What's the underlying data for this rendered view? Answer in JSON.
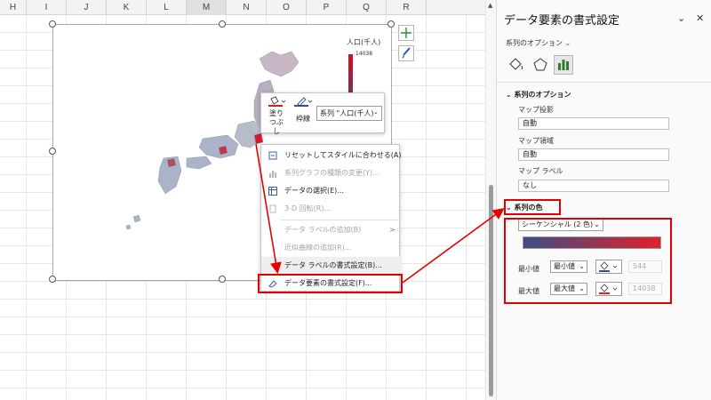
{
  "sheet": {
    "columns": [
      "H",
      "I",
      "J",
      "K",
      "L",
      "M",
      "N",
      "O",
      "P",
      "Q",
      "R"
    ]
  },
  "chart": {
    "legend_title": "人口(千人)",
    "legend_max": "14038",
    "colors": {
      "high": "#cc1122",
      "low": "#2b4f86",
      "land": "#aab3c8"
    }
  },
  "mini_toolbar": {
    "fill_label": "塗りつぶし",
    "outline_label": "枠線",
    "series_select": "系列 \"人口(千人)\""
  },
  "context_menu": {
    "items": [
      {
        "label": "リセットしてスタイルに合わせる(A)",
        "enabled": true
      },
      {
        "label": "系列グラフの種類の変更(Y)...",
        "enabled": false
      },
      {
        "label": "データの選択(E)...",
        "enabled": true
      },
      {
        "label": "3-D 回転(R)...",
        "enabled": false
      },
      {
        "label": "データ ラベルの追加(B)",
        "enabled": false
      },
      {
        "label": "近似曲線の追加(R)...",
        "enabled": false
      },
      {
        "label": "データ ラベルの書式設定(B)...",
        "enabled": true
      },
      {
        "label": "データ要素の書式設定(F)...",
        "enabled": true
      }
    ]
  },
  "pane": {
    "title": "データ要素の書式設定",
    "series_options_link": "系列のオプション",
    "section_series_options": "系列のオプション",
    "map_projection_label": "マップ投影",
    "map_projection_value": "自動",
    "map_area_label": "マップ領域",
    "map_area_value": "自動",
    "map_labels_label": "マップ ラベル",
    "map_labels_value": "なし",
    "section_series_color": "系列の色",
    "color_scheme": "シーケンシャル (2 色)",
    "min_label": "最小値",
    "min_type": "最小値",
    "min_value": "544",
    "max_label": "最大値",
    "max_type": "最大値",
    "max_value": "14038",
    "gradient_colors": {
      "start": "#3d4d86",
      "end": "#e2202a"
    },
    "annotation_color": "#e30000"
  }
}
